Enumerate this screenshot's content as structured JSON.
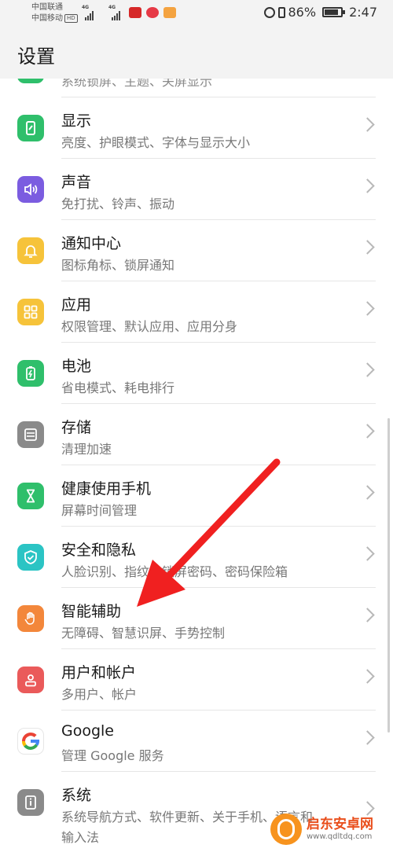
{
  "status_bar": {
    "carrier_1": "中国联通",
    "carrier_2": "中国移动",
    "hd_badge": "HD",
    "signal_1_type": "4G",
    "signal_2_type": "4G",
    "battery_percent": "86%",
    "battery_level": 0.86,
    "time": "2:47"
  },
  "header": {
    "title": "设置"
  },
  "partial_item": {
    "subtitle": "系统锁屏、主题、关屏显示"
  },
  "items": [
    {
      "title": "显示",
      "subtitle": "亮度、护眼模式、字体与显示大小",
      "icon": "display-icon",
      "color": "#2fbf6b"
    },
    {
      "title": "声音",
      "subtitle": "免打扰、铃声、振动",
      "icon": "sound-icon",
      "color": "#7b5ce0"
    },
    {
      "title": "通知中心",
      "subtitle": "图标角标、锁屏通知",
      "icon": "bell-icon",
      "color": "#f6c33a"
    },
    {
      "title": "应用",
      "subtitle": "权限管理、默认应用、应用分身",
      "icon": "apps-icon",
      "color": "#f6c33a"
    },
    {
      "title": "电池",
      "subtitle": "省电模式、耗电排行",
      "icon": "battery-icon",
      "color": "#2fbf6b"
    },
    {
      "title": "存储",
      "subtitle": "清理加速",
      "icon": "storage-icon",
      "color": "#8a8a8a"
    },
    {
      "title": "健康使用手机",
      "subtitle": "屏幕时间管理",
      "icon": "hourglass-icon",
      "color": "#2fbf6b"
    },
    {
      "title": "安全和隐私",
      "subtitle": "人脸识别、指纹、锁屏密码、密码保险箱",
      "icon": "shield-icon",
      "color": "#2bc4c4"
    },
    {
      "title": "智能辅助",
      "subtitle": "无障碍、智慧识屏、手势控制",
      "icon": "hand-icon",
      "color": "#f3873b"
    },
    {
      "title": "用户和帐户",
      "subtitle": "多用户、帐户",
      "icon": "user-icon",
      "color": "#ea5a5a"
    },
    {
      "title": "Google",
      "subtitle": "管理 Google 服务",
      "icon": "google-icon",
      "color": "#ffffff"
    },
    {
      "title": "系统",
      "subtitle": "系统导航方式、软件更新、关于手机、语言和",
      "subtitle_line2": "输入法",
      "icon": "info-icon",
      "color": "#8a8a8a"
    }
  ],
  "watermark": {
    "name": "启东安卓网",
    "url": "www.qdltdq.com"
  }
}
